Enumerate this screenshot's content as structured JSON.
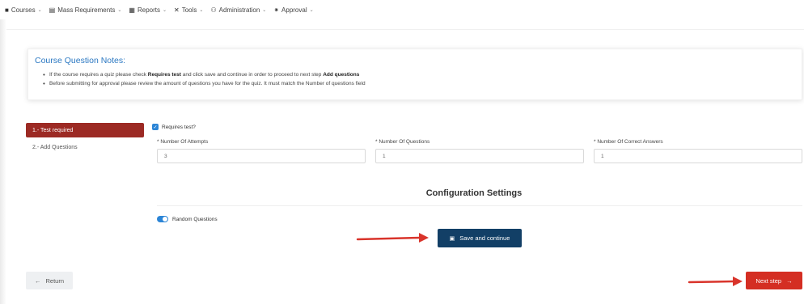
{
  "nav": {
    "items": [
      {
        "icon": "book-icon",
        "glyph": "■",
        "label": "Courses"
      },
      {
        "icon": "database-icon",
        "glyph": "▤",
        "label": "Mass Requirements"
      },
      {
        "icon": "report-icon",
        "glyph": "▦",
        "label": "Reports"
      },
      {
        "icon": "tools-icon",
        "glyph": "✕",
        "label": "Tools"
      },
      {
        "icon": "users-icon",
        "glyph": "⚇",
        "label": "Administration"
      },
      {
        "icon": "approval-icon",
        "glyph": "⁕",
        "label": "Approval"
      }
    ],
    "chevron": "⌄"
  },
  "notes": {
    "title": "Course Question Notes:",
    "line1_pre": "If the course requires a quiz please check ",
    "line1_bold1": "Requires test",
    "line1_mid": " and click save and continue in order to proceed to next step ",
    "line1_bold2": "Add questions",
    "line2": "Before submitting for approval please review the amount of questions you have for the quiz. It must match the Number of questions field"
  },
  "steps": {
    "active": "1.- Test required",
    "second": "2.- Add Questions"
  },
  "form": {
    "requires_test_label": "Requires test?",
    "requires_test_checked": true,
    "attempts_label": "* Number Of Attempts",
    "attempts_value": "3",
    "questions_label": "* Number Of Questions",
    "questions_value": "1",
    "correct_label": "* Number Of Correct Answers",
    "correct_value": "1"
  },
  "config": {
    "title": "Configuration Settings",
    "random_label": "Random Questions",
    "random_on": true
  },
  "buttons": {
    "save": "Save and continue",
    "return": "Return",
    "next": "Next step"
  },
  "colors": {
    "accent_blue": "#2c85d6",
    "save_navy": "#123f66",
    "step_red": "#9c2a24",
    "next_red": "#d42e23",
    "arrow_red": "#d9342b"
  }
}
